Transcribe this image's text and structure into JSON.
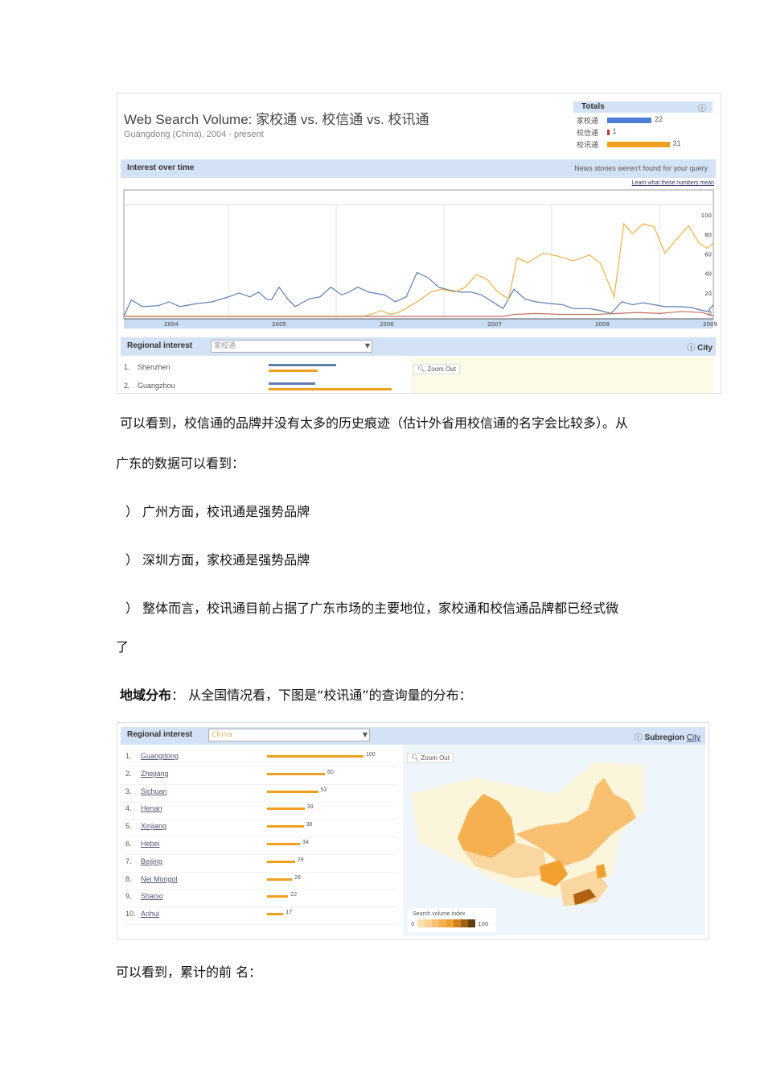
{
  "shot1": {
    "title": "Web Search Volume: 家校通  vs. 校信通  vs. 校讯通",
    "subtitle": "Guangdong (China), 2004 - present",
    "totals": {
      "label": "Totals",
      "help_icon": "help-circle-icon",
      "items": [
        {
          "term": "家校通",
          "value": "22",
          "color": "#4a7fd4",
          "frac": 0.22
        },
        {
          "term": "校信通",
          "value": "1",
          "color": "#b03a2e",
          "frac": 0.01
        },
        {
          "term": "校讯通",
          "value": "31",
          "color": "#f0a020",
          "frac": 0.31
        }
      ]
    },
    "interest_label": "Interest over time",
    "news_note": "News stories weren't found for your query",
    "learn_link": "Learn what these numbers mean",
    "regional_label": "Regional interest",
    "regional_select": "家校通",
    "city_label": "City",
    "zoom_out": "Zoom Out",
    "rows": [
      {
        "rank": "1.",
        "name": "Shenzhen",
        "blue": 0.55,
        "orange": 0.4
      },
      {
        "rank": "2.",
        "name": "Guangzhou",
        "blue": 0.38,
        "orange": 1.0
      }
    ]
  },
  "chart_data": {
    "type": "line",
    "title": "Interest over time",
    "x_tick_labels": [
      "2004",
      "2005",
      "2006",
      "2007",
      "2008",
      "2009"
    ],
    "y_tick_labels": [
      "100",
      "80",
      "60",
      "40",
      "20",
      "0"
    ],
    "xlim": [
      2003.53,
      2009.0
    ],
    "ylim": [
      0,
      100
    ],
    "series": [
      {
        "name": "家校通",
        "color": "#5b7fb5",
        "points": [
          [
            2003.53,
            0
          ],
          [
            2003.6,
            17
          ],
          [
            2003.7,
            10
          ],
          [
            2003.85,
            11
          ],
          [
            2003.95,
            15
          ],
          [
            2004.05,
            10
          ],
          [
            2004.2,
            13
          ],
          [
            2004.35,
            15
          ],
          [
            2004.5,
            20
          ],
          [
            2004.6,
            24
          ],
          [
            2004.7,
            20
          ],
          [
            2004.78,
            25
          ],
          [
            2004.85,
            18
          ],
          [
            2004.9,
            17
          ],
          [
            2004.97,
            30
          ],
          [
            2005.05,
            18
          ],
          [
            2005.12,
            10
          ],
          [
            2005.25,
            18
          ],
          [
            2005.35,
            20
          ],
          [
            2005.45,
            30
          ],
          [
            2005.55,
            22
          ],
          [
            2005.62,
            25
          ],
          [
            2005.7,
            30
          ],
          [
            2005.8,
            25
          ],
          [
            2005.95,
            22
          ],
          [
            2006.05,
            15
          ],
          [
            2006.15,
            20
          ],
          [
            2006.25,
            45
          ],
          [
            2006.35,
            40
          ],
          [
            2006.45,
            30
          ],
          [
            2006.55,
            27
          ],
          [
            2006.65,
            25
          ],
          [
            2006.75,
            25
          ],
          [
            2006.85,
            22
          ],
          [
            2006.95,
            15
          ],
          [
            2007.05,
            8
          ],
          [
            2007.15,
            28
          ],
          [
            2007.25,
            18
          ],
          [
            2007.35,
            15
          ],
          [
            2007.5,
            13
          ],
          [
            2007.6,
            12
          ],
          [
            2007.7,
            8
          ],
          [
            2007.85,
            8
          ],
          [
            2007.95,
            6
          ],
          [
            2008.05,
            3
          ],
          [
            2008.15,
            15
          ],
          [
            2008.25,
            12
          ],
          [
            2008.35,
            14
          ],
          [
            2008.45,
            12
          ],
          [
            2008.55,
            10
          ],
          [
            2008.7,
            10
          ],
          [
            2008.8,
            9
          ],
          [
            2008.9,
            6
          ],
          [
            2008.95,
            5
          ],
          [
            2009.0,
            12
          ]
        ]
      },
      {
        "name": "校讯通",
        "color": "#f0b040",
        "points": [
          [
            2003.53,
            0
          ],
          [
            2005.75,
            0
          ],
          [
            2005.82,
            2
          ],
          [
            2005.92,
            6
          ],
          [
            2006.0,
            2
          ],
          [
            2006.1,
            5
          ],
          [
            2006.25,
            15
          ],
          [
            2006.38,
            25
          ],
          [
            2006.48,
            28
          ],
          [
            2006.6,
            25
          ],
          [
            2006.7,
            30
          ],
          [
            2006.8,
            43
          ],
          [
            2006.9,
            38
          ],
          [
            2007.0,
            25
          ],
          [
            2007.1,
            18
          ],
          [
            2007.18,
            60
          ],
          [
            2007.28,
            55
          ],
          [
            2007.42,
            65
          ],
          [
            2007.55,
            62
          ],
          [
            2007.7,
            57
          ],
          [
            2007.85,
            63
          ],
          [
            2007.95,
            55
          ],
          [
            2008.08,
            20
          ],
          [
            2008.17,
            95
          ],
          [
            2008.25,
            85
          ],
          [
            2008.35,
            95
          ],
          [
            2008.45,
            92
          ],
          [
            2008.55,
            65
          ],
          [
            2008.65,
            78
          ],
          [
            2008.77,
            93
          ],
          [
            2008.87,
            75
          ],
          [
            2008.94,
            70
          ],
          [
            2009.0,
            75
          ]
        ]
      },
      {
        "name": "校信通",
        "color": "#c07060",
        "points": [
          [
            2003.53,
            0
          ],
          [
            2007.05,
            0
          ],
          [
            2007.15,
            2
          ],
          [
            2007.35,
            3
          ],
          [
            2007.6,
            2
          ],
          [
            2007.9,
            2
          ],
          [
            2008.1,
            3
          ],
          [
            2008.3,
            4
          ],
          [
            2008.5,
            3
          ],
          [
            2008.7,
            5
          ],
          [
            2008.9,
            4
          ],
          [
            2009.0,
            0
          ]
        ]
      }
    ]
  },
  "text": {
    "p1": "可以看到，校信通的品牌并没有太多的历史痕迹（估计外省用校信通的名字会比较多）。从",
    "p2": "广东的数据可以看到：",
    "b1": "）  广州方面，校讯通是强势品牌",
    "b2": "）  深圳方面，家校通是强势品牌",
    "b3": "）  整体而言，校讯通目前占据了广东市场的主要地位，家校通和校信通品牌都已经式微",
    "b3cont": "了",
    "geo_bold": "地域分布",
    "geo_rest": "：  从全国情况看，下图是“校讯通”的查询量的分布：",
    "last": "可以看到，累计的前      名："
  },
  "shot2": {
    "regional_label": "Regional interest",
    "select": "China",
    "subregion": "Subregion",
    "city": "City",
    "zoom_out": "Zoom Out",
    "legend_title": "Search volume index",
    "legend_min": "0",
    "legend_max": "100",
    "rows": [
      {
        "rank": "1.",
        "name": "Guangdong",
        "value": 100
      },
      {
        "rank": "2.",
        "name": "Zhejiang",
        "value": 60
      },
      {
        "rank": "3.",
        "name": "Sichuan",
        "value": 53
      },
      {
        "rank": "4.",
        "name": "Henan",
        "value": 39
      },
      {
        "rank": "5.",
        "name": "Xinjiang",
        "value": 38
      },
      {
        "rank": "6.",
        "name": "Hebei",
        "value": 34
      },
      {
        "rank": "7.",
        "name": "Beijing",
        "value": 29
      },
      {
        "rank": "8.",
        "name": "Nei Mongol",
        "value": 26
      },
      {
        "rank": "9.",
        "name": "Shanxi",
        "value": 22
      },
      {
        "rank": "10.",
        "name": "Anhui",
        "value": 17
      }
    ]
  }
}
